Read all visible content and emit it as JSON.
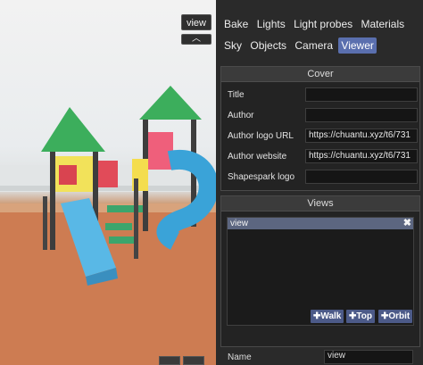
{
  "viewport": {
    "view_button": "view",
    "collapse_glyph": "︿"
  },
  "tabs": [
    "Bake",
    "Lights",
    "Light probes",
    "Materials",
    "Sky",
    "Objects",
    "Camera",
    "Viewer"
  ],
  "active_tab": "Viewer",
  "cover": {
    "title": "Cover",
    "fields": [
      {
        "label": "Title",
        "value": ""
      },
      {
        "label": "Author",
        "value": ""
      },
      {
        "label": "Author logo URL",
        "value": "https://chuantu.xyz/t6/731"
      },
      {
        "label": "Author website",
        "value": "https://chuantu.xyz/t6/731"
      },
      {
        "label": "Shapespark logo",
        "value": ""
      }
    ]
  },
  "views": {
    "title": "Views",
    "items": [
      {
        "label": "view",
        "remove_glyph": "✖"
      }
    ],
    "buttons": {
      "walk": "✚Walk",
      "top": "✚Top",
      "orbit": "✚Orbit"
    }
  },
  "name_field": {
    "label": "Name",
    "value": "view"
  },
  "colors": {
    "active_tab": "#5a6fae",
    "button_blue": "#4c5a88",
    "selected_item": "#5c6680"
  }
}
